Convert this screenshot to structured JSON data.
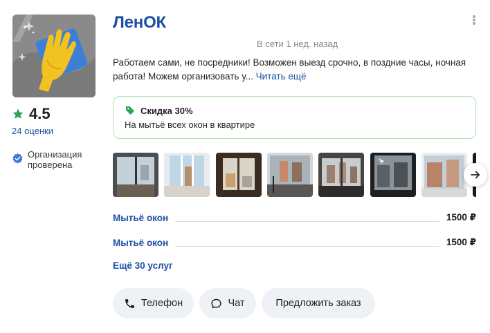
{
  "provider": {
    "name": "ЛенОК",
    "online_status": "В сети 1 нед. назад",
    "rating": "4.5",
    "reviews": "24 оценки",
    "verified": "Организация проверена"
  },
  "description": {
    "text": "Работаем сами, не посредники! Возможен выезд срочно, в поздние часы, ночная работа! Можем организовать у...",
    "read_more": "Читать ещё"
  },
  "promo": {
    "title": "Скидка 30%",
    "text": "На мытьё всех окон в квартире"
  },
  "services": [
    {
      "name": "Мытьё окон",
      "price": "1500 ₽"
    },
    {
      "name": "Мытьё окон",
      "price": "1500 ₽"
    }
  ],
  "more_services": "Ещё 30 услуг",
  "actions": {
    "phone": "Телефон",
    "chat": "Чат",
    "offer": "Предложить заказ"
  },
  "colors": {
    "accent": "#1b4fa3",
    "star": "#2ea44f",
    "promo_border": "#b3dfb0",
    "button_bg": "#eef2f6"
  },
  "icons": {
    "more": "vertical-dots-icon",
    "star": "star-icon",
    "verified": "verified-check-icon",
    "promo": "price-tag-icon",
    "gallery_next": "arrow-right-icon",
    "phone": "phone-icon",
    "chat": "chat-bubble-icon"
  }
}
